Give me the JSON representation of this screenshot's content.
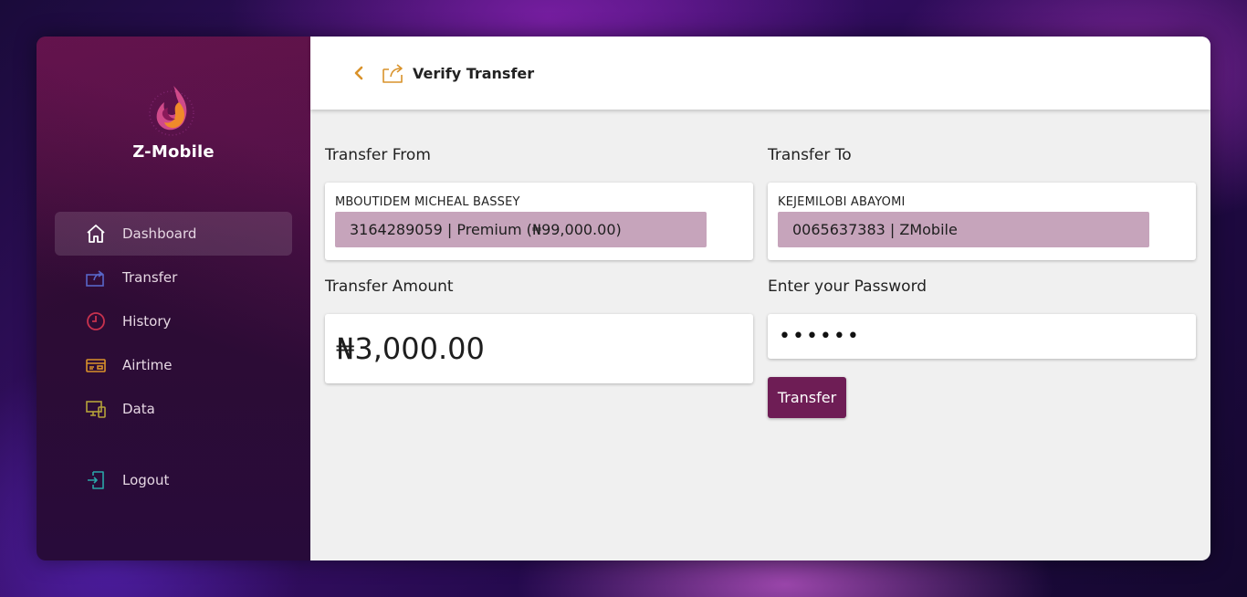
{
  "brand": {
    "name": "Z-Mobile",
    "logo_icon": "flame-logo"
  },
  "sidebar": {
    "items": [
      {
        "label": "Dashboard",
        "icon": "home-icon",
        "active": true
      },
      {
        "label": "Transfer",
        "icon": "transfer-icon"
      },
      {
        "label": "History",
        "icon": "clock-icon"
      },
      {
        "label": "Airtime",
        "icon": "card-icon"
      },
      {
        "label": "Data",
        "icon": "devices-icon"
      }
    ],
    "logout_label": "Logout"
  },
  "header": {
    "title": "Verify Transfer",
    "back_icon": "chevron-left-icon",
    "title_icon": "share-icon"
  },
  "form": {
    "from": {
      "label": "Transfer From",
      "account_name": "MBOUTIDEM MICHEAL BASSEY",
      "account_detail": "3164289059 | Premium (₦99,000.00)"
    },
    "to": {
      "label": "Transfer To",
      "account_name": "KEJEMILOBI ABAYOMI",
      "account_detail": "0065637383 | ZMobile"
    },
    "amount": {
      "label": "Transfer Amount",
      "value": "₦3,000.00"
    },
    "password": {
      "label": "Enter your Password",
      "value": "••••••"
    },
    "submit_label": "Transfer"
  },
  "colors": {
    "accent": "#6e1d55",
    "pill": "#c6a4bb",
    "icon_orange": "#d9922a",
    "icon_blue": "#5866c8",
    "icon_red": "#c8324e",
    "icon_teal": "#2aa6a8"
  }
}
